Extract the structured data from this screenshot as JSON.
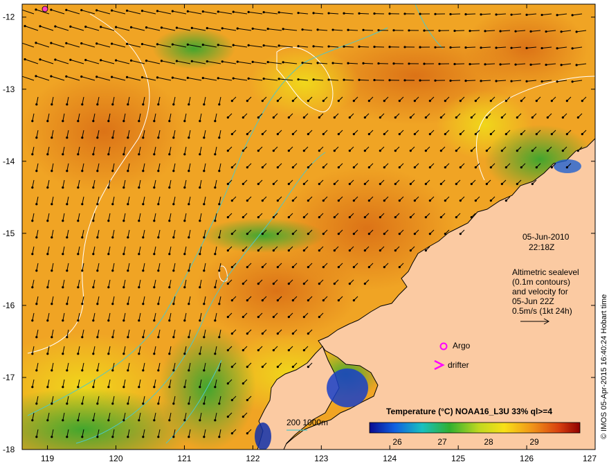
{
  "map": {
    "date": "05-Jun-2010",
    "time": "22:18Z",
    "altimetry_lines": [
      "Altimetric sealevel",
      "(0.1m contours)",
      "and velocity for",
      "05-Jun 22Z",
      "0.5m/s (1kt 24h)"
    ],
    "legend_argo": "Argo",
    "legend_drifter": "drifter",
    "depth_contour_label": "200  1000m",
    "colorbar_title": "Temperature (°C) NOAA16_L3U 33% ql>=4",
    "colorbar_ticks": [
      "26",
      "27",
      "28",
      "29"
    ],
    "credit": "© IMOS 05-Apr-2015 16:40:24 Hobart time",
    "lon_ticks": [
      "119",
      "120",
      "121",
      "122",
      "123",
      "124",
      "125",
      "126",
      "127"
    ],
    "lat_ticks": [
      "-12",
      "-13",
      "-14",
      "-15",
      "-16",
      "-17",
      "-18"
    ],
    "colors": {
      "land": "#fbcaa2",
      "sst_warm": "#f0a020",
      "sst_hot": "#e07818",
      "sst_mid": "#f2d21a",
      "sst_cool": "#2ea82e",
      "sst_cold": "#1838b8",
      "contour_depth": "#4ec8c8",
      "argo": "#ff00ff",
      "drifter": "#ff00ff"
    }
  }
}
